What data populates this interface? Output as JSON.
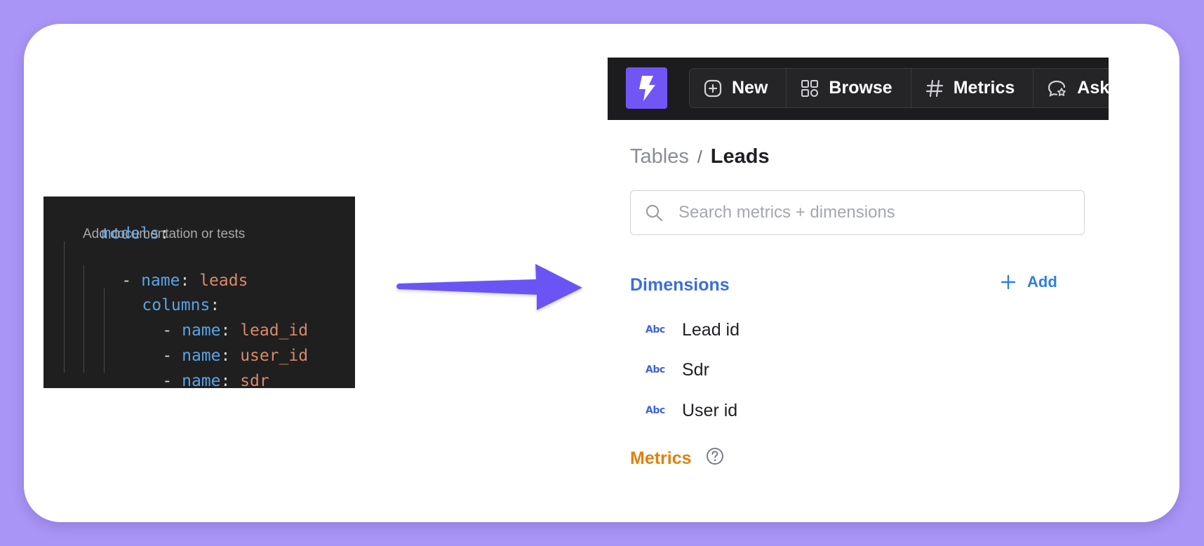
{
  "code": {
    "lines": [
      {
        "indent": 0,
        "dash": "",
        "key": "models",
        "sep": ":",
        "val": ""
      },
      {
        "indent": 1,
        "dash": "- ",
        "key": "name",
        "sep": ": ",
        "val": "leads"
      },
      {
        "indent": 2,
        "dash": "",
        "key": "columns",
        "sep": ":",
        "val": ""
      },
      {
        "indent": 3,
        "dash": "- ",
        "key": "name",
        "sep": ": ",
        "val": "lead_id"
      },
      {
        "indent": 3,
        "dash": "- ",
        "key": "name",
        "sep": ": ",
        "val": "user_id"
      },
      {
        "indent": 3,
        "dash": "- ",
        "key": "name",
        "sep": ": ",
        "val": "sdr"
      }
    ],
    "codelens": "Add documentation or tests"
  },
  "nav": {
    "items": [
      {
        "label": "New",
        "icon": "plus-square-icon"
      },
      {
        "label": "Browse",
        "icon": "grid-icon"
      },
      {
        "label": "Metrics",
        "icon": "hash-icon"
      },
      {
        "label": "Ask",
        "icon": "chat-star-icon"
      }
    ]
  },
  "breadcrumb": {
    "parent": "Tables",
    "separator": "/",
    "current": "Leads"
  },
  "search": {
    "placeholder": "Search metrics + dimensions"
  },
  "dimensions": {
    "title": "Dimensions",
    "add_label": "Add",
    "type_badge": "Abc",
    "items": [
      "Lead id",
      "Sdr",
      "User id"
    ]
  },
  "metrics": {
    "title": "Metrics"
  },
  "colors": {
    "background": "#a995f6",
    "brand": "#7156f5",
    "dimensions": "#3b6fd8",
    "metrics": "#e0800f",
    "add": "#2f7fe0"
  }
}
